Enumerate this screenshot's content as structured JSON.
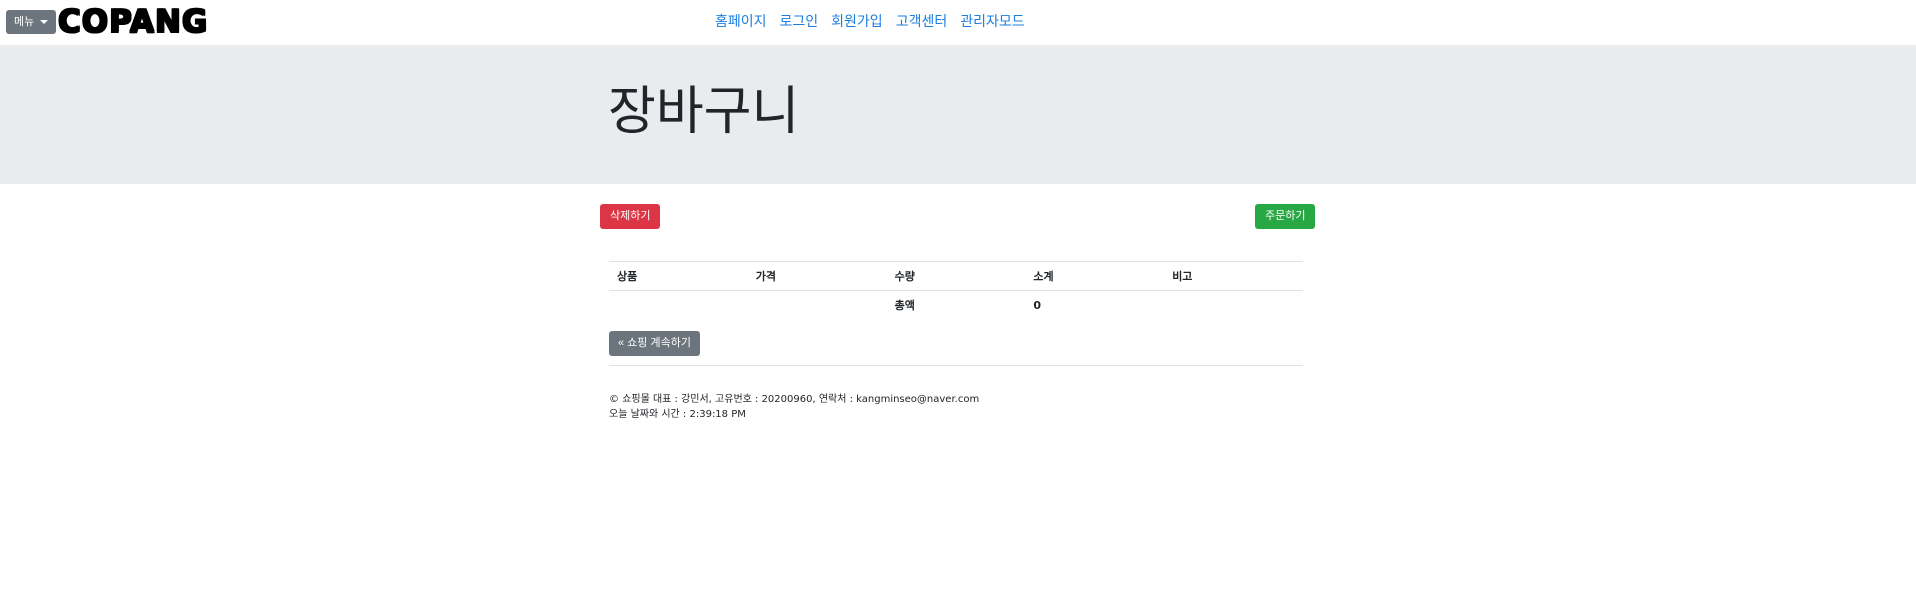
{
  "navbar": {
    "menu_label": "메뉴",
    "logo_text": "COPANG",
    "links": [
      "홈페이지",
      "로그인",
      "회원가입",
      "고객센터",
      "관리자모드"
    ]
  },
  "jumbotron": {
    "title": "장바구니"
  },
  "actions": {
    "delete_label": "삭제하기",
    "order_label": "주문하기",
    "continue_label": "« 쇼핑 계속하기"
  },
  "table": {
    "headers": [
      "상품",
      "가격",
      "수량",
      "소계",
      "비고"
    ],
    "total_label": "총액",
    "total_value": "0"
  },
  "footer": {
    "line1": "© 쇼핑몰 대표 : 강민서, 고유번호 : 20200960, 연락처 : kangminseo@naver.com",
    "line2": "오늘 날짜와 시간 : 2:39:18 PM"
  },
  "colors": {
    "link": "#1a7fe0",
    "danger": "#dc3545",
    "success": "#28a745",
    "secondary": "#6c757d",
    "jumbotron": "#e9ecef"
  }
}
